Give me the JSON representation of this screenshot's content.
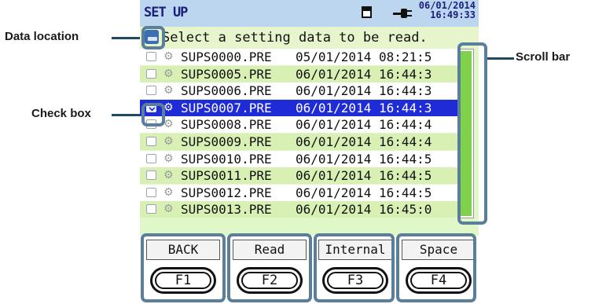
{
  "screen": {
    "title": "SET UP",
    "date": "06/01/2014",
    "time": "16:49:33",
    "prompt": "Select a setting data to be read."
  },
  "files": [
    {
      "name": "SUPS0000.PRE",
      "datetime": "05/01/2014 08:21:5",
      "checked": false
    },
    {
      "name": "SUPS0005.PRE",
      "datetime": "06/01/2014 16:44:3",
      "checked": false
    },
    {
      "name": "SUPS0006.PRE",
      "datetime": "06/01/2014 16:44:3",
      "checked": false
    },
    {
      "name": "SUPS0007.PRE",
      "datetime": "06/01/2014 16:44:3",
      "checked": true
    },
    {
      "name": "SUPS0008.PRE",
      "datetime": "06/01/2014 16:44:4",
      "checked": false
    },
    {
      "name": "SUPS0009.PRE",
      "datetime": "06/01/2014 16:44:4",
      "checked": false
    },
    {
      "name": "SUPS0010.PRE",
      "datetime": "06/01/2014 16:44:5",
      "checked": false
    },
    {
      "name": "SUPS0011.PRE",
      "datetime": "06/01/2014 16:44:5",
      "checked": false
    },
    {
      "name": "SUPS0012.PRE",
      "datetime": "06/01/2014 16:44:5",
      "checked": false
    },
    {
      "name": "SUPS0013.PRE",
      "datetime": "06/01/2014 16:45:0",
      "checked": false
    }
  ],
  "function_keys": [
    {
      "label": "BACK",
      "key": "F1"
    },
    {
      "label": "Read",
      "key": "F2"
    },
    {
      "label": "Internal",
      "key": "F3"
    },
    {
      "label": "Space",
      "key": "F4"
    }
  ],
  "callouts": {
    "data_location": "Data location",
    "check_box": "Check box",
    "scroll_bar": "Scroll bar"
  },
  "icons": [
    "card-icon",
    "plug-icon",
    "data-location-icon",
    "gear-icon",
    "checkbox-icon"
  ],
  "colors": {
    "selection": "#1f2bd6",
    "row_highlight": "#d9f0b4",
    "title_bar": "#bcd6f0",
    "scroll_thumb": "#7fd04a",
    "callout_frame": "#5a7f9a"
  }
}
